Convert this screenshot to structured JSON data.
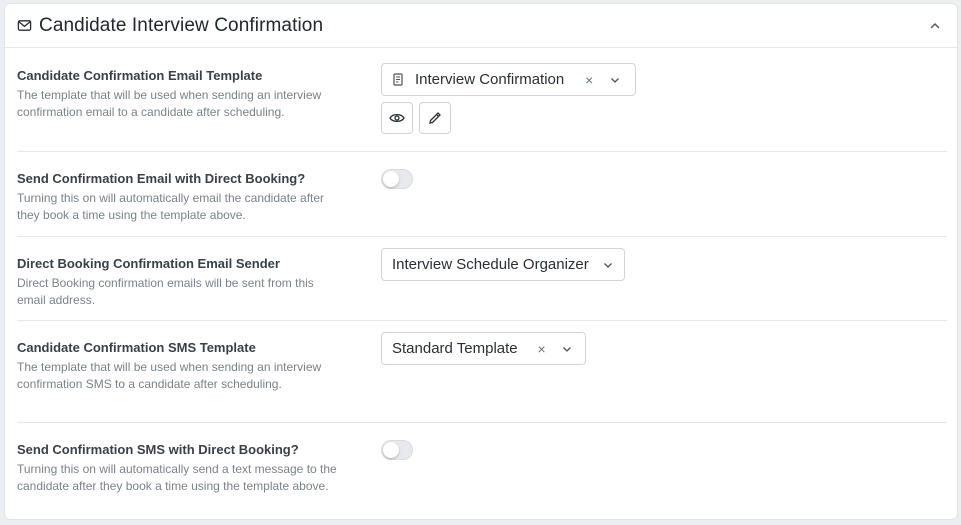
{
  "section": {
    "title": "Candidate Interview Confirmation",
    "icons": {
      "header": "mail-icon",
      "collapse": "chevron-up-icon"
    }
  },
  "settings": [
    {
      "label": "Candidate Confirmation Email Template",
      "description": "The template that will be used when sending an interview confirmation email to a candidate after scheduling.",
      "control": "select",
      "value": "Interview Confirmation",
      "has_clear": true,
      "leading_icon": "document-icon",
      "actions": [
        "eye-icon",
        "pencil-icon"
      ]
    },
    {
      "label": "Send Confirmation Email with Direct Booking?",
      "description": "Turning this on will automatically email the candidate after they book a time using the template above.",
      "control": "toggle",
      "on": false
    },
    {
      "label": "Direct Booking Confirmation Email Sender",
      "description": "Direct Booking confirmation emails will be sent from this email address.",
      "control": "select",
      "value": "Interview Schedule Organizer",
      "has_clear": false
    },
    {
      "label": "Candidate Confirmation SMS Template",
      "description": "The template that will be used when sending an interview confirmation SMS to a candidate after scheduling.",
      "control": "select",
      "value": "Standard Template",
      "has_clear": true
    },
    {
      "label": "Send Confirmation SMS with Direct Booking?",
      "description": "Turning this on will automatically send a text message to the candidate after they book a time using the template above.",
      "control": "toggle",
      "on": false
    }
  ],
  "clear_glyph": "×"
}
